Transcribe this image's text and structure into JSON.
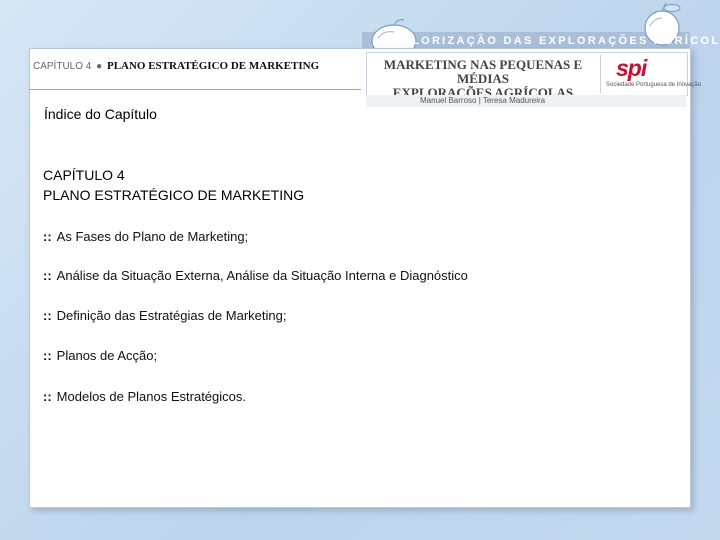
{
  "header": {
    "chapter": "CAPÍTULO 4",
    "bullet": "●",
    "title": "PLANO ESTRATÉGICO DE MARKETING"
  },
  "branding": {
    "banner": "VALORIZAÇÃO DAS EXPLORAÇÕES AGRÍCOLAS",
    "book_title_line1": "MARKETING NAS PEQUENAS E MÉDIAS",
    "book_title_line2": "EXPLORAÇÕES AGRÍCOLAS",
    "publisher_logo": "spi",
    "publisher_name": "Sociedade Portuguesa de Inovação",
    "authors": "Manuel Barroso | Teresa Madureira",
    "accent_color": "#c8102e",
    "banner_color": "#a9bfd8"
  },
  "content": {
    "index_title": "Índice do Capítulo",
    "chapter_number": "CAPÍTULO 4",
    "chapter_name": "PLANO ESTRATÉGICO DE MARKETING",
    "bullet_marker": "::",
    "items": [
      "As Fases do Plano de Marketing;",
      "Análise da Situação Externa, Análise da Situação Interna e Diagnóstico",
      "Definição das Estratégias de Marketing;",
      "Planos de Acção;",
      "Modelos de Planos Estratégicos."
    ]
  }
}
